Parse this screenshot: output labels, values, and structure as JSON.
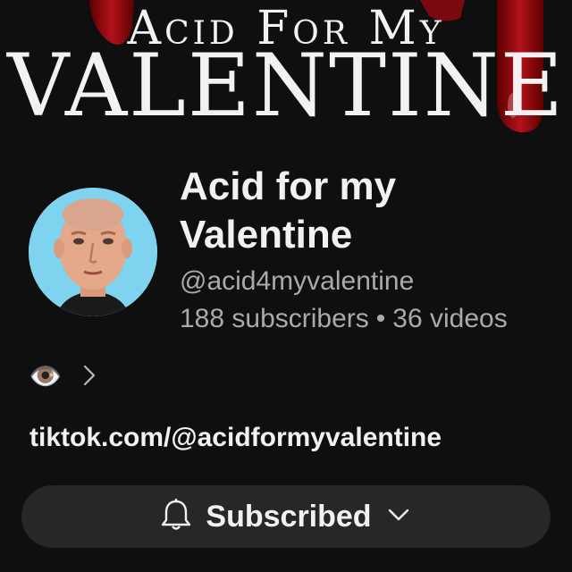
{
  "banner": {
    "line1": "Acid For My",
    "line2": "VALENTINE"
  },
  "channel": {
    "name": "Acid for my Valentine",
    "handle": "@acid4myvalentine",
    "subscribers": "188 subscribers",
    "separator": "•",
    "videos": "36 videos"
  },
  "description": {
    "emoji": "👁️",
    "expand_icon": "chevron-right-icon"
  },
  "link": {
    "text": "tiktok.com/@acidformyvalentine"
  },
  "subscribe_button": {
    "label": "Subscribed",
    "bell_icon": "bell-icon",
    "dropdown_icon": "chevron-down-icon"
  },
  "colors": {
    "background": "#0f0f0f",
    "secondary_text": "#aaaaaa",
    "button_bg": "#272727",
    "avatar_bg": "#7fd3ee",
    "blood_red": "#8b0000"
  }
}
